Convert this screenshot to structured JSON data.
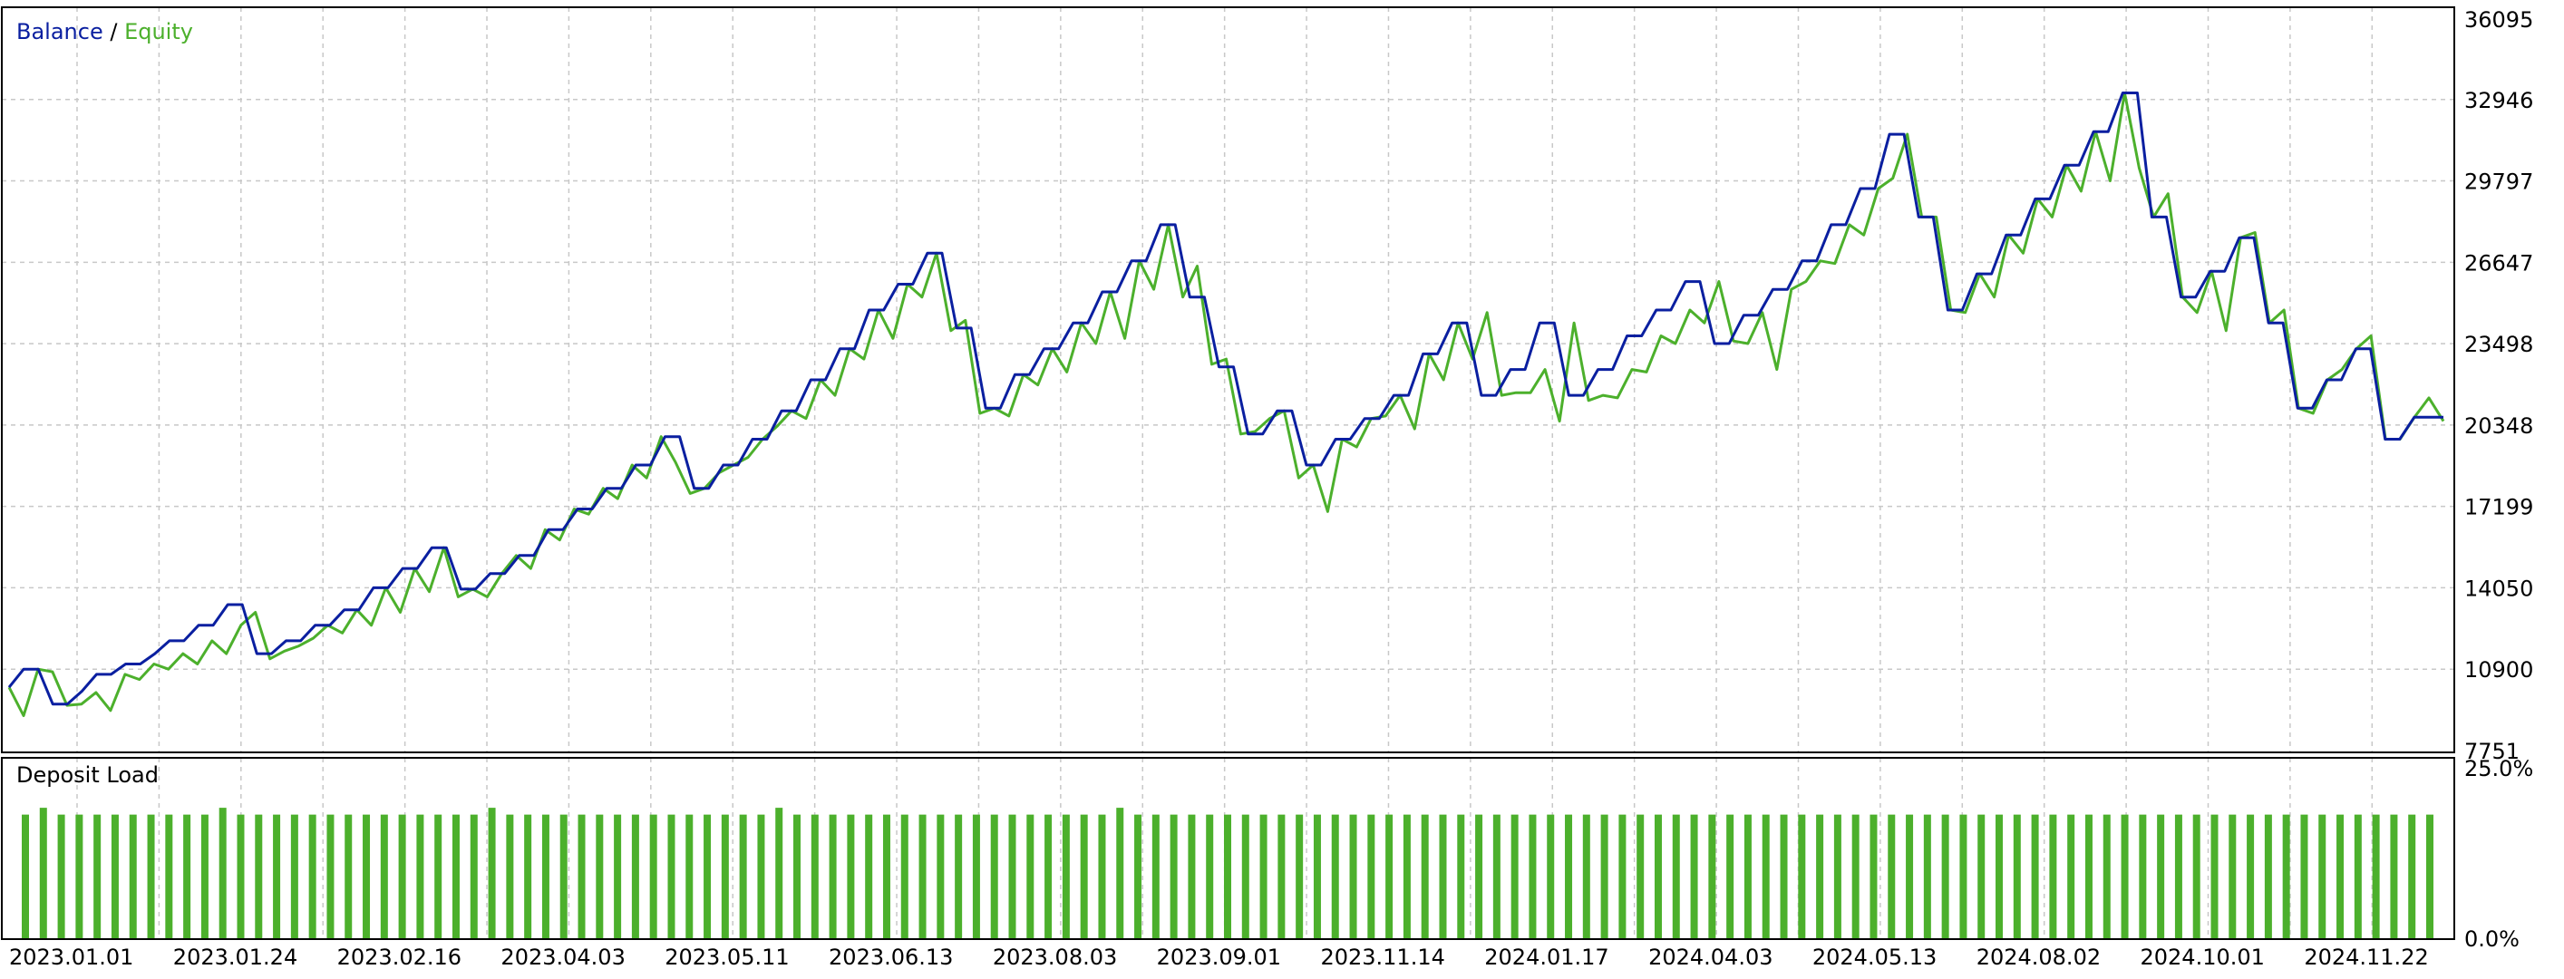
{
  "legend": {
    "balance": "Balance",
    "sep": " / ",
    "equity": "Equity"
  },
  "deposit_load_title": "Deposit Load",
  "colors": {
    "balance": "#0a1fa0",
    "equity": "#4cb02c",
    "bar": "#4cb02c",
    "grid": "#c8c8c8"
  },
  "chart_data": [
    {
      "type": "line",
      "series": [
        {
          "name": "Balance",
          "values": [
            10200,
            10900,
            10900,
            9550,
            9550,
            10050,
            10700,
            10700,
            11100,
            11100,
            11500,
            12000,
            12000,
            12600,
            12600,
            13400,
            13400,
            11500,
            11500,
            12000,
            12000,
            12600,
            12600,
            13200,
            13200,
            14050,
            14050,
            14800,
            14800,
            15600,
            15600,
            14000,
            14000,
            14600,
            14600,
            15300,
            15300,
            16300,
            16300,
            17100,
            17100,
            17900,
            17900,
            18800,
            18800,
            19900,
            19900,
            17900,
            17900,
            18800,
            18800,
            19800,
            19800,
            20900,
            20900,
            22100,
            22100,
            23300,
            23300,
            24800,
            24800,
            25800,
            25800,
            27000,
            27000,
            24100,
            24100,
            21000,
            21000,
            22300,
            22300,
            23300,
            23300,
            24300,
            24300,
            25500,
            25500,
            26700,
            26700,
            28100,
            28100,
            25300,
            25300,
            22600,
            22600,
            20000,
            20000,
            20900,
            20900,
            18800,
            18800,
            19800,
            19800,
            20600,
            20600,
            21500,
            21500,
            23100,
            23100,
            24300,
            24300,
            21500,
            21500,
            22500,
            22500,
            24300,
            24300,
            21500,
            21500,
            22500,
            22500,
            23800,
            23800,
            24800,
            24800,
            25900,
            25900,
            23500,
            23500,
            24600,
            24600,
            25600,
            25600,
            26700,
            26700,
            28100,
            28100,
            29500,
            29500,
            31600,
            31600,
            28400,
            28400,
            24800,
            24800,
            26200,
            26200,
            27700,
            27700,
            29100,
            29100,
            30400,
            30400,
            31700,
            31700,
            33200,
            33200,
            28400,
            28400,
            25300,
            25300,
            26300,
            26300,
            27600,
            27600,
            24300,
            24300,
            21000,
            21000,
            22100,
            22100,
            23300,
            23300,
            19800,
            19800,
            20650,
            20650,
            20650
          ]
        },
        {
          "name": "Equity",
          "values": [
            10200,
            9100,
            10900,
            10800,
            9500,
            9550,
            10000,
            9300,
            10700,
            10500,
            11100,
            10900,
            11500,
            11100,
            12000,
            11500,
            12600,
            13100,
            11300,
            11600,
            11800,
            12100,
            12600,
            12300,
            13200,
            12600,
            14050,
            13100,
            14800,
            13900,
            15600,
            13700,
            14000,
            13700,
            14600,
            15300,
            14800,
            16300,
            15900,
            17100,
            16900,
            17900,
            17500,
            18800,
            18300,
            19900,
            18900,
            17700,
            17900,
            18500,
            18800,
            19100,
            19800,
            20300,
            20900,
            20600,
            22100,
            21500,
            23300,
            22900,
            24800,
            23700,
            25800,
            25300,
            27000,
            24000,
            24400,
            20800,
            21000,
            20700,
            22300,
            21900,
            23300,
            22400,
            24300,
            23500,
            25500,
            23700,
            26700,
            25600,
            28100,
            25300,
            26500,
            22700,
            22900,
            20000,
            20100,
            20600,
            20900,
            18300,
            18800,
            17000,
            19800,
            19500,
            20600,
            20700,
            21500,
            20200,
            23100,
            22100,
            24300,
            22900,
            24700,
            21500,
            21600,
            21600,
            22500,
            20500,
            24300,
            21300,
            21500,
            21400,
            22500,
            22400,
            23800,
            23500,
            24800,
            24300,
            25900,
            23600,
            23500,
            24700,
            22500,
            25600,
            25900,
            26700,
            26600,
            28100,
            27700,
            29500,
            29900,
            31600,
            28400,
            28400,
            24800,
            24700,
            26200,
            25300,
            27700,
            27000,
            29100,
            28400,
            30400,
            29400,
            31700,
            29800,
            33200,
            30300,
            28400,
            29300,
            25300,
            24700,
            26300,
            24000,
            27600,
            27800,
            24300,
            24800,
            21000,
            20800,
            22100,
            22500,
            23300,
            23800,
            19800,
            19800,
            20650,
            21400,
            20500
          ]
        }
      ],
      "ylim": [
        7751,
        36095
      ],
      "yticks": [
        "36095",
        "32946",
        "29797",
        "26647",
        "23498",
        "20348",
        "17199",
        "14050",
        "10900",
        "7751"
      ],
      "grid": true,
      "legend_position": "top-left"
    },
    {
      "type": "bar",
      "title": "Deposit Load",
      "values": [
        18,
        19,
        18,
        18,
        18,
        18,
        18,
        18,
        18,
        18,
        18,
        19,
        18,
        18,
        18,
        18,
        18,
        18,
        18,
        18,
        18,
        18,
        18,
        18,
        18,
        18,
        19,
        18,
        18,
        18,
        18,
        18,
        18,
        18,
        18,
        18,
        18,
        18,
        18,
        18,
        18,
        18,
        19,
        18,
        18,
        18,
        18,
        18,
        18,
        18,
        18,
        18,
        18,
        18,
        18,
        18,
        18,
        18,
        18,
        18,
        18,
        19,
        18,
        18,
        18,
        18,
        18,
        18,
        18,
        18,
        18,
        18,
        18,
        18,
        18,
        18,
        18,
        18,
        18,
        18,
        18,
        18,
        18,
        18,
        18,
        18,
        18,
        18,
        18,
        18,
        18,
        18,
        18,
        18,
        18,
        18,
        18,
        18,
        18,
        18,
        18,
        18,
        18,
        18,
        18,
        18,
        18,
        18,
        18,
        18,
        18,
        18,
        18,
        18,
        18,
        18,
        18,
        18,
        18,
        18,
        18,
        18,
        18,
        18,
        18,
        18,
        18,
        18,
        18,
        18,
        18,
        18,
        18,
        18,
        18
      ],
      "yticks": [
        "25.0%",
        "0.0%"
      ],
      "ylim": [
        0,
        25
      ]
    }
  ],
  "x_axis": {
    "ticks": [
      "2023.01.01",
      "2023.01.24",
      "2023.02.16",
      "2023.04.03",
      "2023.05.11",
      "2023.06.13",
      "2023.08.03",
      "2023.09.01",
      "2023.11.14",
      "2024.01.17",
      "2024.04.03",
      "2024.05.13",
      "2024.08.02",
      "2024.10.01",
      "2024.11.22"
    ]
  }
}
